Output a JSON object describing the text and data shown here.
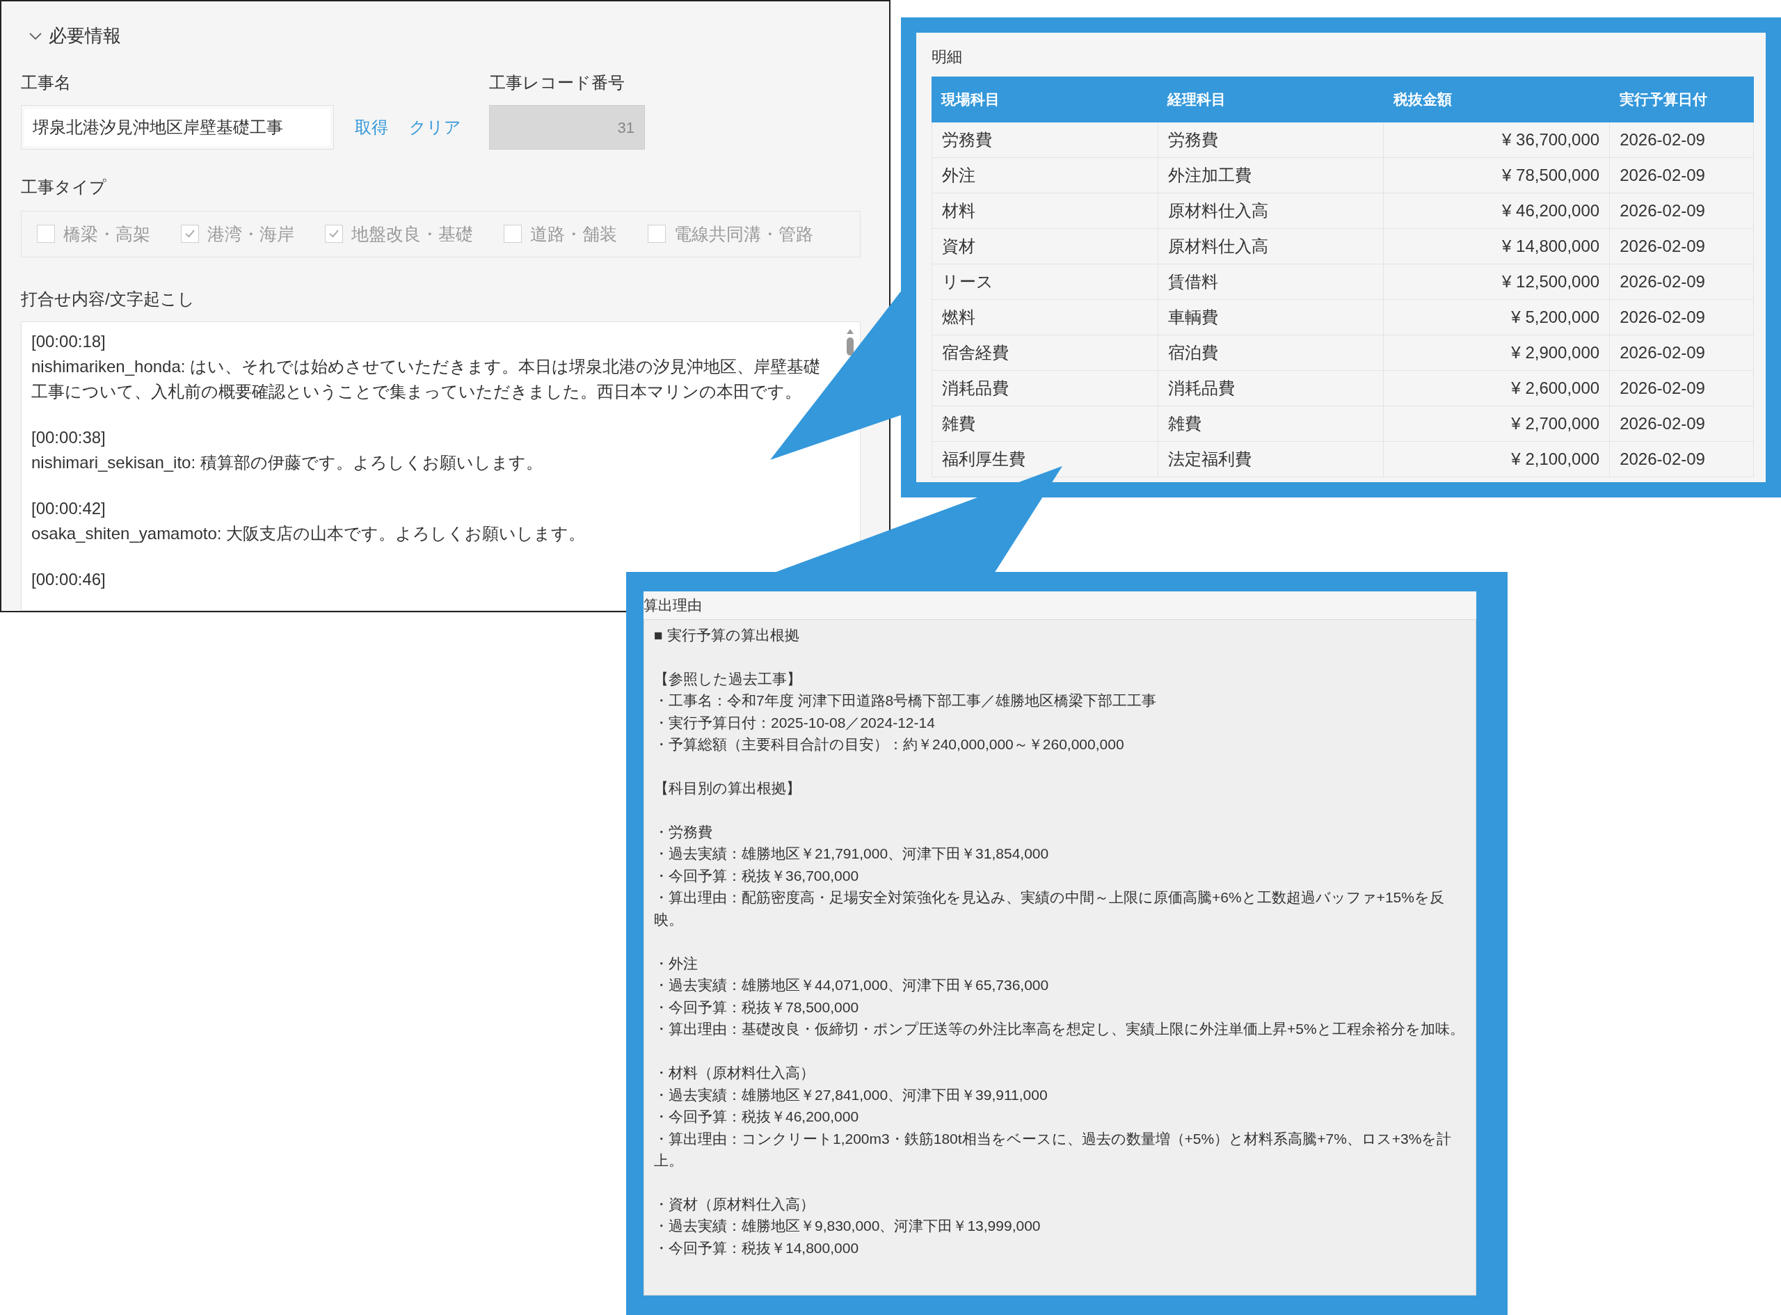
{
  "section": {
    "title": "必要情報",
    "expanded": true
  },
  "fields": {
    "name_label": "工事名",
    "name_value": "堺泉北港汐見沖地区岸壁基礎工事",
    "fetch_link": "取得",
    "clear_link": "クリア",
    "record_label": "工事レコード番号",
    "record_value": "31"
  },
  "type_label": "工事タイプ",
  "types": [
    {
      "label": "橋梁・高架",
      "checked": false
    },
    {
      "label": "港湾・海岸",
      "checked": true
    },
    {
      "label": "地盤改良・基礎",
      "checked": true
    },
    {
      "label": "道路・舗装",
      "checked": false
    },
    {
      "label": "電線共同溝・管路",
      "checked": false
    }
  ],
  "transcript_label": "打合せ内容/文字起こし",
  "transcript": [
    {
      "time": "[00:00:18]",
      "text": "nishimariken_honda: はい、それでは始めさせていただきます。本日は堺泉北港の汐見沖地区、岸壁基礎工事について、入札前の概要確認ということで集まっていただきました。西日本マリンの本田です。"
    },
    {
      "time": "[00:00:38]",
      "text": "nishimari_sekisan_ito: 積算部の伊藤です。よろしくお願いします。"
    },
    {
      "time": "[00:00:42]",
      "text": "osaka_shiten_yamamoto: 大阪支店の山本です。よろしくお願いします。"
    },
    {
      "time": "[00:00:46]"
    }
  ],
  "detail": {
    "title": "明細",
    "columns": [
      "現場科目",
      "経理科目",
      "税抜金額",
      "実行予算日付"
    ],
    "rows": [
      [
        "労務費",
        "労務費",
        "¥ 36,700,000",
        "2026-02-09"
      ],
      [
        "外注",
        "外注加工費",
        "¥ 78,500,000",
        "2026-02-09"
      ],
      [
        "材料",
        "原材料仕入高",
        "¥ 46,200,000",
        "2026-02-09"
      ],
      [
        "資材",
        "原材料仕入高",
        "¥ 14,800,000",
        "2026-02-09"
      ],
      [
        "リース",
        "賃借料",
        "¥ 12,500,000",
        "2026-02-09"
      ],
      [
        "燃料",
        "車輌費",
        "¥ 5,200,000",
        "2026-02-09"
      ],
      [
        "宿舎経費",
        "宿泊費",
        "¥ 2,900,000",
        "2026-02-09"
      ],
      [
        "消耗品費",
        "消耗品費",
        "¥ 2,600,000",
        "2026-02-09"
      ],
      [
        "雑費",
        "雑費",
        "¥ 2,700,000",
        "2026-02-09"
      ],
      [
        "福利厚生費",
        "法定福利費",
        "¥ 2,100,000",
        "2026-02-09"
      ]
    ]
  },
  "reason": {
    "title": "算出理由",
    "blocks": [
      [
        "■ 実行予算の算出根拠"
      ],
      [
        "【参照した過去工事】",
        "・工事名：令和7年度 河津下田道路8号橋下部工事／雄勝地区橋梁下部工工事",
        "・実行予算日付：2025-10-08／2024-12-14",
        "・予算総額（主要科目合計の目安）：約￥240,000,000～￥260,000,000"
      ],
      [
        "【科目別の算出根拠】"
      ],
      [
        "・労務費",
        "・過去実績：雄勝地区￥21,791,000、河津下田￥31,854,000",
        "・今回予算：税抜￥36,700,000",
        "・算出理由：配筋密度高・足場安全対策強化を見込み、実績の中間～上限に原価高騰+6%と工数超過バッファ+15%を反映。"
      ],
      [
        "・外注",
        "・過去実績：雄勝地区￥44,071,000、河津下田￥65,736,000",
        "・今回予算：税抜￥78,500,000",
        "・算出理由：基礎改良・仮締切・ポンプ圧送等の外注比率高を想定し、実績上限に外注単価上昇+5%と工程余裕分を加味。"
      ],
      [
        "・材料（原材料仕入高）",
        "・過去実績：雄勝地区￥27,841,000、河津下田￥39,911,000",
        "・今回予算：税抜￥46,200,000",
        "・算出理由：コンクリート1,200m3・鉄筋180t相当をベースに、過去の数量増（+5%）と材料系高騰+7%、ロス+3%を計上。"
      ],
      [
        "・資材（原材料仕入高）",
        "・過去実績：雄勝地区￥9,830,000、河津下田￥13,999,000",
        "・今回予算：税抜￥14,800,000"
      ]
    ]
  }
}
